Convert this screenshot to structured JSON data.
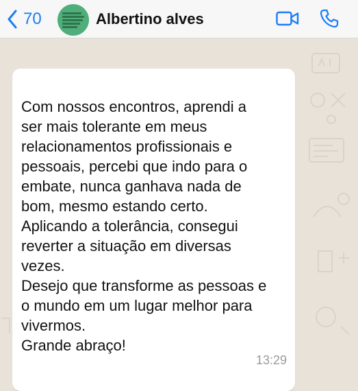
{
  "header": {
    "back_count": "70",
    "contact_name": "Albertino alves"
  },
  "icons": {
    "back": "chevron-left-icon",
    "video": "video-camera-icon",
    "call": "phone-icon",
    "accent_color": "#1a7cf5"
  },
  "message": {
    "lines": [
      "Com nossos encontros, aprendi a",
      "ser mais tolerante em meus",
      "relacionamentos profissionais e",
      "pessoais, percebi que indo para o",
      "embate, nunca ganhava nada de",
      "bom, mesmo estando certo.",
      "Aplicando a tolerância, consegui",
      "reverter a situação em diversas",
      "vezes.",
      "Desejo que transforme as pessoas e",
      "o mundo em um lugar melhor para",
      "vivermos.",
      "Grande abraço!"
    ],
    "time": "13:29"
  }
}
